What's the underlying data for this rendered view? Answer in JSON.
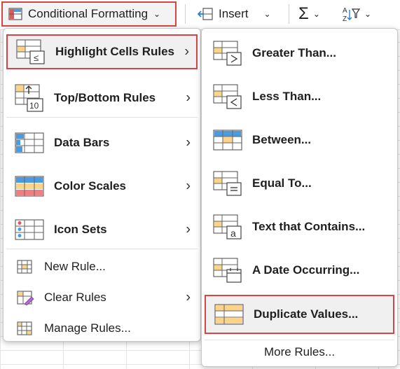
{
  "ribbon": {
    "cf_label": "Conditional Formatting",
    "insert_label": "Insert",
    "sum_glyph": "Σ",
    "sort_glyph": "A↓Z"
  },
  "left_menu": {
    "items": [
      {
        "label": "Highlight Cells Rules",
        "icon": "highlight-cells-icon"
      },
      {
        "label": "Top/Bottom Rules",
        "icon": "top-bottom-icon"
      },
      {
        "label": "Data Bars",
        "icon": "data-bars-icon"
      },
      {
        "label": "Color Scales",
        "icon": "color-scales-icon"
      },
      {
        "label": "Icon Sets",
        "icon": "icon-sets-icon"
      },
      {
        "label": "New Rule...",
        "icon": "new-rule-icon"
      },
      {
        "label": "Clear Rules",
        "icon": "clear-rules-icon"
      },
      {
        "label": "Manage Rules...",
        "icon": "manage-rules-icon"
      }
    ]
  },
  "right_menu": {
    "items": [
      {
        "label": "Greater Than...",
        "icon": "greater-than-icon"
      },
      {
        "label": "Less Than...",
        "icon": "less-than-icon"
      },
      {
        "label": "Between...",
        "icon": "between-icon"
      },
      {
        "label": "Equal To...",
        "icon": "equal-to-icon"
      },
      {
        "label": "Text that Contains...",
        "icon": "text-contains-icon"
      },
      {
        "label": "A Date Occurring...",
        "icon": "date-occurring-icon"
      },
      {
        "label": "Duplicate Values...",
        "icon": "duplicate-values-icon"
      }
    ],
    "more_rules": "More Rules..."
  },
  "colors": {
    "highlight_border": "#d64545",
    "cell_orange": "#fbd48a",
    "cell_blue": "#4a9be0",
    "cell_red": "#f08080"
  }
}
